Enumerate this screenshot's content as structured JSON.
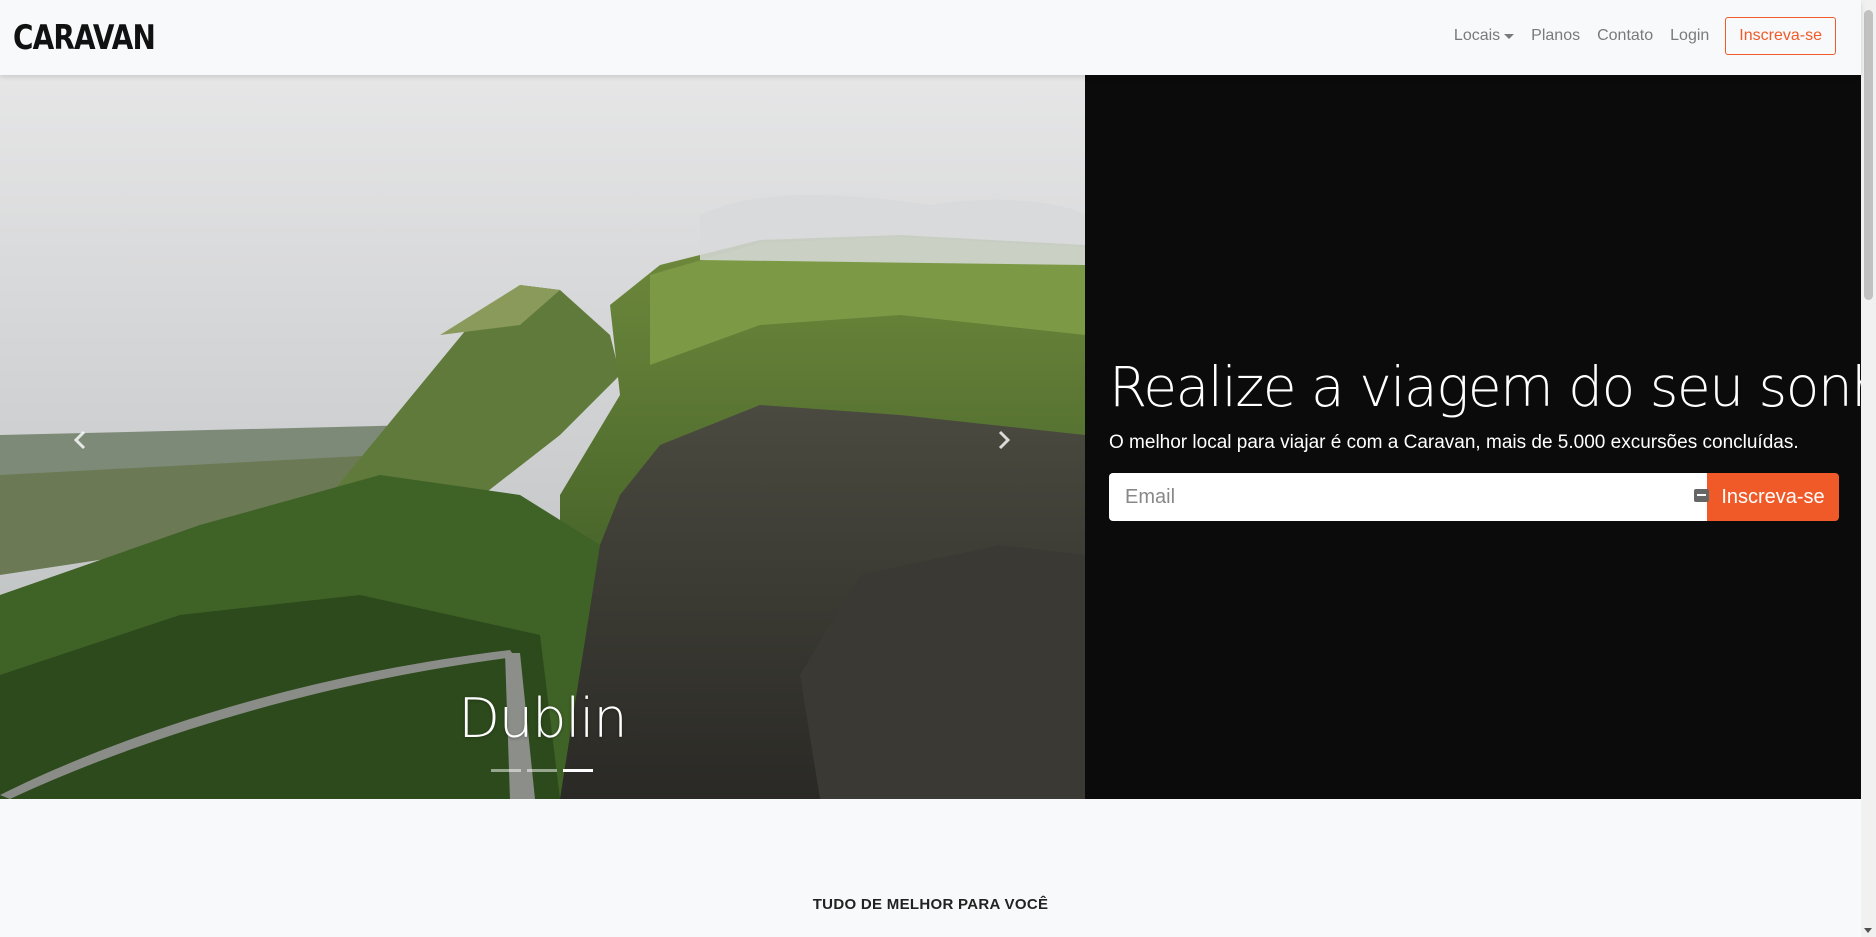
{
  "navbar": {
    "brand": "CARAVAN",
    "links": [
      {
        "label": "Locais",
        "dropdown": true
      },
      {
        "label": "Planos"
      },
      {
        "label": "Contato"
      },
      {
        "label": "Login"
      }
    ],
    "cta_label": "Inscreva-se"
  },
  "carousel": {
    "caption": "Dublin",
    "slide_count": 3,
    "active_slide": 3,
    "prev_icon": "chevron-left-icon",
    "next_icon": "chevron-right-icon"
  },
  "hero": {
    "title": "Realize a viagem do seu sonho",
    "subtitle": "O melhor local para viajar é com a Caravan, mais de 5.000 excursões concluídas.",
    "email_placeholder": "Email",
    "submit_label": "Inscreva-se"
  },
  "section": {
    "heading": "TUDO DE MELHOR PARA VOCÊ"
  },
  "colors": {
    "accent": "#f05a28",
    "panel_bg": "#0b0b0c",
    "page_bg": "#f8f9fa"
  }
}
